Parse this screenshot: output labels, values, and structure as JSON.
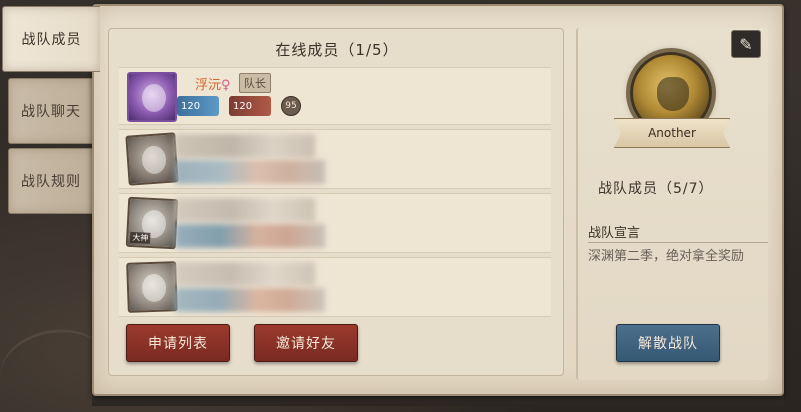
{
  "tabs": [
    {
      "label": "战队成员",
      "active": true
    },
    {
      "label": "战队聊天",
      "active": false
    },
    {
      "label": "战队规则",
      "active": false
    }
  ],
  "members_panel": {
    "title": "在线成员（1/5）",
    "leader": {
      "name": "浮沅",
      "gender_symbol": "♀",
      "badge": "队长",
      "level1": "120",
      "level2": "120",
      "level3": "95"
    },
    "other_members": [
      {
        "avatar_tag": ""
      },
      {
        "avatar_tag": "大神"
      },
      {
        "avatar_tag": ""
      }
    ]
  },
  "buttons": {
    "apply_list": "申请列表",
    "invite_friends": "邀请好友",
    "disband": "解散战队"
  },
  "team_info": {
    "name": "Another",
    "member_count_label": "战队成员（5/7）",
    "declaration_title": "战队宣言",
    "declaration_text": "深渊第二季，绝对拿全奖励"
  },
  "colors": {
    "accent_red": "#8a3226",
    "accent_blue": "#426782",
    "paper": "#e8dfcd"
  }
}
